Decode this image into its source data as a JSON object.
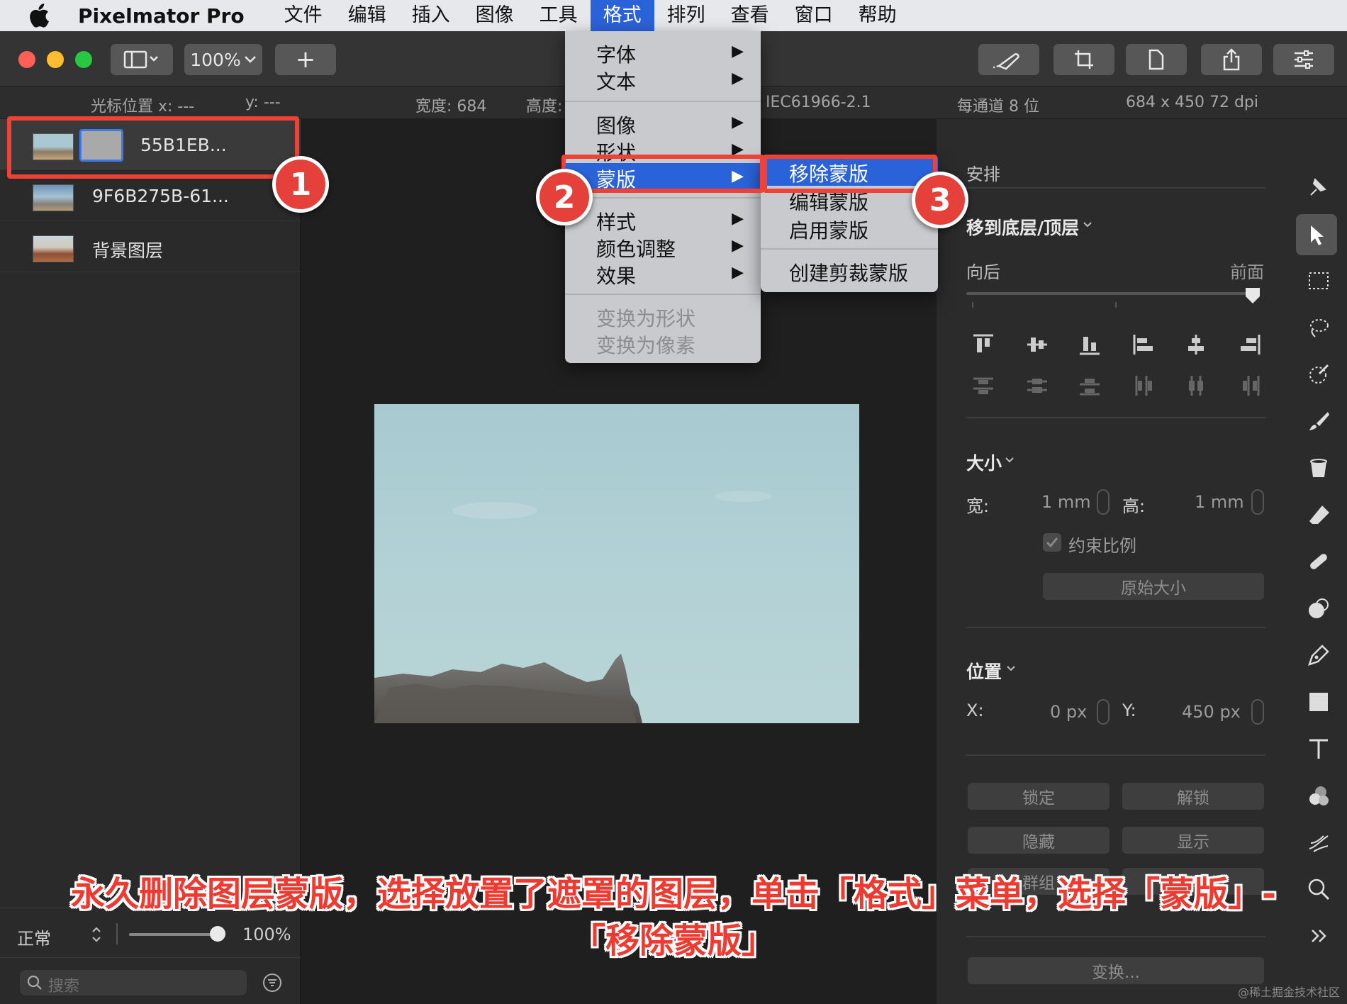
{
  "menubar": {
    "app_name": "Pixelmator Pro",
    "items": [
      "文件",
      "编辑",
      "插入",
      "图像",
      "工具",
      "格式",
      "排列",
      "查看",
      "窗口",
      "帮助"
    ],
    "active_index": 5
  },
  "toolbar": {
    "zoom": "100%",
    "add": "+"
  },
  "infobar": {
    "cursor_label": "光标位置 x:  ---",
    "cursor_y": "y:  ---",
    "width": "宽度:  684",
    "height": "高度:",
    "profile": "IEC61966-2.1",
    "depth": "每通道 8 位",
    "size_dpi": "684 x 450 72 dpi"
  },
  "layers": [
    {
      "name": "55B1EB...",
      "selected": true,
      "has_mask": true
    },
    {
      "name": "9F6B275B-61...",
      "selected": false,
      "has_mask": false
    },
    {
      "name": "背景图层",
      "selected": false,
      "has_mask": false
    }
  ],
  "layers_bottom": {
    "blend_mode": "正常",
    "opacity": "100%",
    "opacity_fraction": 1.0,
    "search_placeholder": "搜索"
  },
  "format_menu": {
    "items": [
      {
        "label": "字体",
        "submenu": true,
        "disabled": false
      },
      {
        "label": "文本",
        "submenu": true,
        "disabled": false
      },
      {
        "label": "图像",
        "submenu": true,
        "disabled": false
      },
      {
        "label": "形状",
        "submenu": true,
        "disabled": false
      },
      {
        "label": "蒙版",
        "submenu": true,
        "disabled": false,
        "highlighted": true
      },
      {
        "label": "样式",
        "submenu": true,
        "disabled": false
      },
      {
        "label": "颜色调整",
        "submenu": true,
        "disabled": false
      },
      {
        "label": "效果",
        "submenu": true,
        "disabled": false
      },
      {
        "label": "变换为形状",
        "submenu": false,
        "disabled": true
      },
      {
        "label": "变换为像素",
        "submenu": false,
        "disabled": true
      }
    ]
  },
  "mask_submenu": {
    "items": [
      {
        "label": "移除蒙版",
        "highlighted": true
      },
      {
        "label": "编辑蒙版"
      },
      {
        "label": "启用蒙版"
      },
      {
        "label": "创建剪裁蒙版"
      }
    ]
  },
  "inspector": {
    "arrange_title": "安排",
    "move_to_label": "移到底层/顶层",
    "backward_label": "向后",
    "forward_label": "前面",
    "size_title": "大小",
    "width_label": "宽:",
    "width_value": "1 mm",
    "height_label": "高:",
    "height_value": "1 mm",
    "constrain_label": "约束比例",
    "original_size_button": "原始大小",
    "position_title": "位置",
    "x_label": "X:",
    "x_value": "0 px",
    "y_label": "Y:",
    "y_value": "450 px",
    "lock_button": "锁定",
    "unlock_button": "解锁",
    "hide_button": "隐藏",
    "show_button": "显示",
    "group_button": "群组",
    "ungroup_button": "取消群组",
    "transform_button": "变换..."
  },
  "annotations": {
    "steps": [
      "1",
      "2",
      "3"
    ],
    "caption_line1": "永久删除图层蒙版，选择放置了遮罩的图层，单击「格式」菜单，选择「蒙版」-",
    "caption_line2": "「移除蒙版」",
    "color": "#ee3a30"
  },
  "watermark": "@稀土掘金技术社区"
}
